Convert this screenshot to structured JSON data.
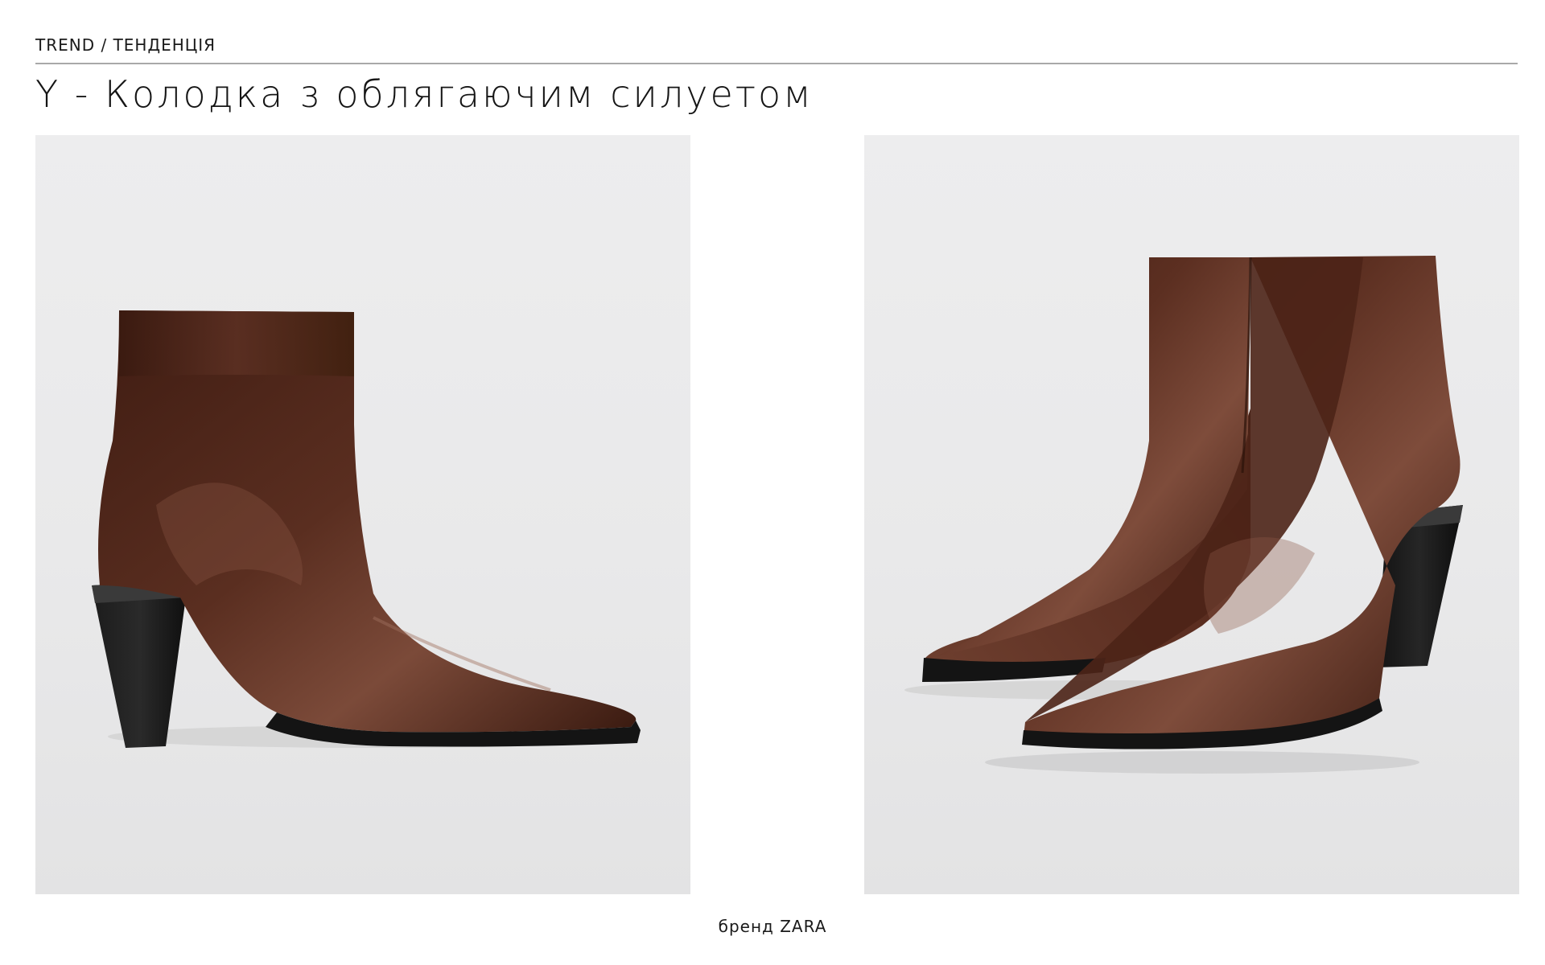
{
  "header": {
    "eyebrow": "TREND / ТЕНДЕНЦІЯ",
    "title": "Y - Колодка з облягаючим силуетом"
  },
  "images": [
    {
      "name": "side-view-boot-photo",
      "subject": "single brown leather pointed-toe ankle boot, side view"
    },
    {
      "name": "pair-of-boots-photo",
      "subject": "pair of brown leather pointed-toe ankle boots"
    }
  ],
  "colors": {
    "leather": "#4a2418",
    "leather_highlight": "#7a4a3a",
    "sole": "#141414",
    "photo_background": "#ebebec",
    "rule": "#a9a9a9"
  },
  "footer": {
    "caption": "бренд ZARA"
  }
}
